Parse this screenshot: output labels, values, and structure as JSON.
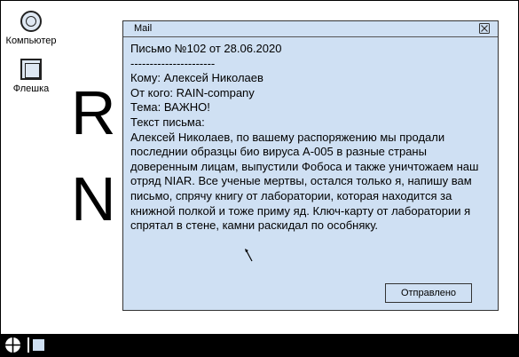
{
  "desktop": {
    "icons": [
      {
        "label": "Компьютер",
        "icon": "computer-icon"
      },
      {
        "label": "Флешка",
        "icon": "flash-drive-icon"
      }
    ],
    "background_letters": [
      "R",
      "N"
    ]
  },
  "mail_window": {
    "title": "Mail",
    "close_icon": "close-icon",
    "lines": [
      "Письмо №102 от 28.06.2020",
      "----------------------",
      "Кому: Алексей Николаев",
      "От кого: RAIN-company",
      "Тема: ВАЖНО!",
      "Текст письма:"
    ],
    "body_text": "Алексей Николаев, по вашему распоряжению мы продали последнии образцы био вируса А-005 в разные страны доверенным лицам, выпустили Фобоса и также уничтожаем наш отряд NIAR. Все ученые мертвы, остался только я, напишу вам письмо, спрячу книгу от лаборатории, которая находится за книжной полкой и тоже приму яд. Ключ-карту от лаборатории я спрятал в стене, камни раскидал по особняку.",
    "status_button_label": "Отправлено",
    "background_color": "#cfe0f3"
  },
  "taskbar": {
    "start_icon": "start-crosshair-icon",
    "items": [
      {
        "icon": "mail-window-icon"
      }
    ],
    "background_color": "#000000"
  }
}
